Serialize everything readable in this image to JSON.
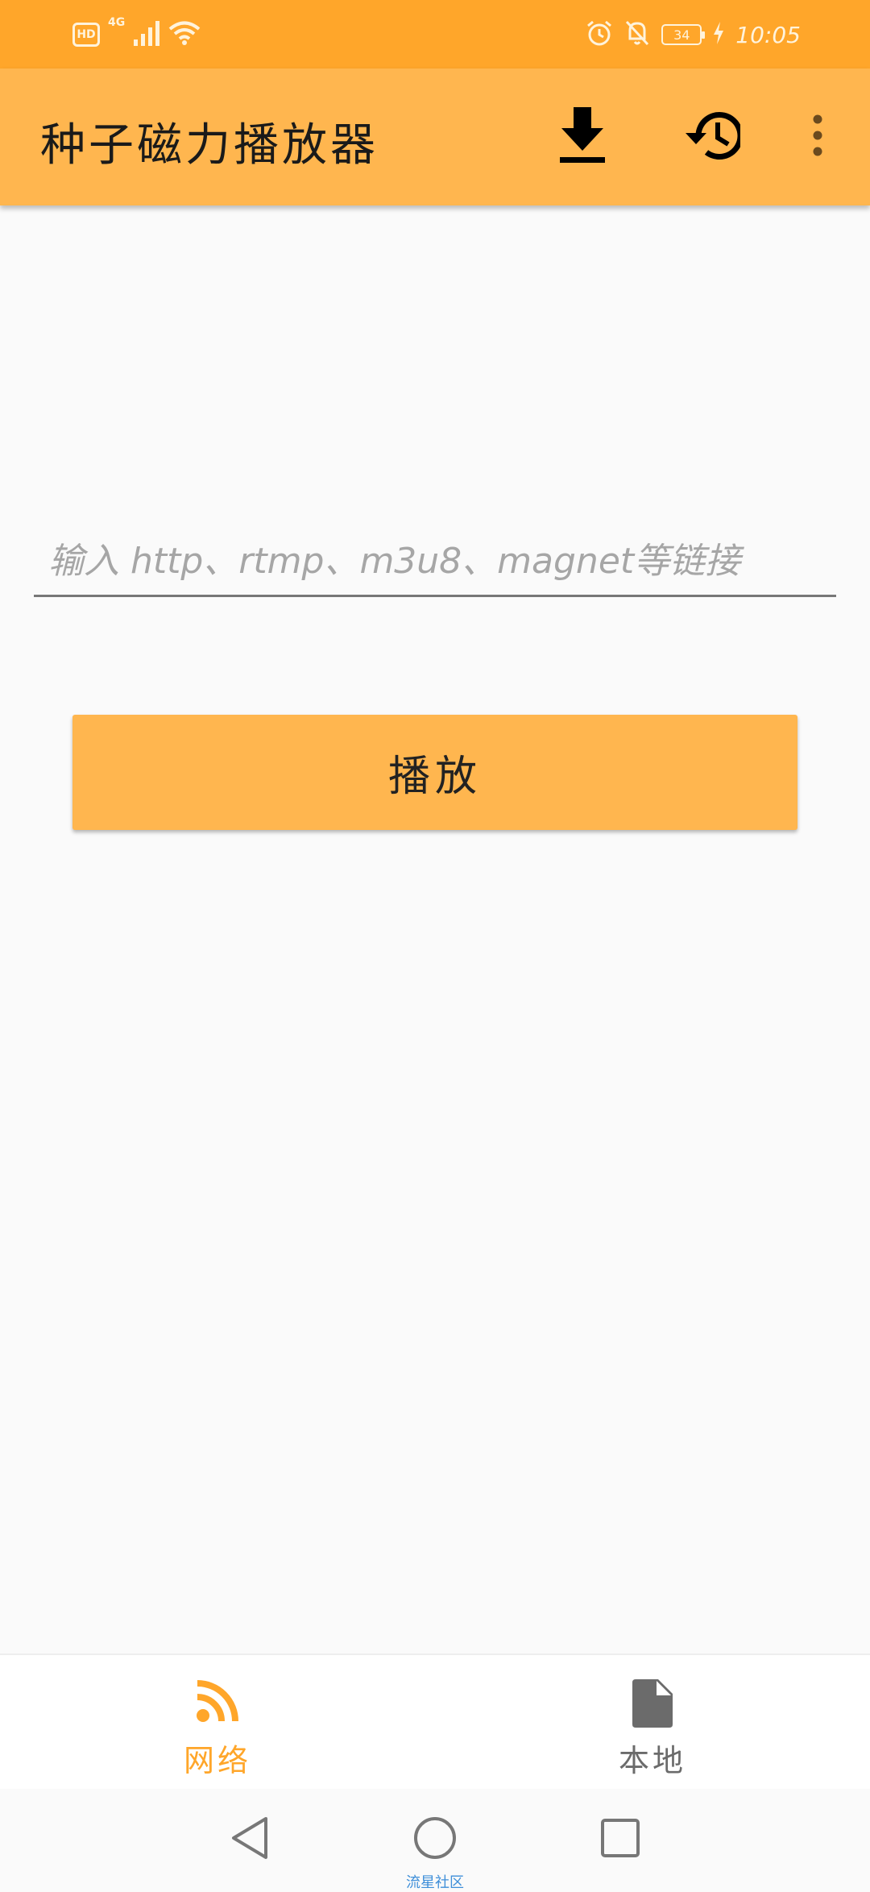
{
  "status_bar": {
    "hd_badge": "HD",
    "network_type": "4G",
    "battery_level": "34",
    "time": "10:05",
    "icons": [
      "signal-icon",
      "wifi-icon",
      "alarm-icon",
      "bell-off-icon",
      "battery-icon",
      "charging-icon"
    ]
  },
  "app_bar": {
    "title": "种子磁力播放器",
    "actions": [
      "download-icon",
      "history-icon",
      "more-vert-icon"
    ],
    "color": "#ffb64f"
  },
  "main": {
    "url_input": {
      "value": "",
      "placeholder": "输入 http、rtmp、m3u8、magnet等链接"
    },
    "play_button_label": "播放"
  },
  "bottom_nav": {
    "items": [
      {
        "label": "网络",
        "icon": "rss-feed-icon",
        "selected": true
      },
      {
        "label": "本地",
        "icon": "file-icon",
        "selected": false
      }
    ],
    "active_color": "#ffa62a"
  },
  "system_nav": {
    "watermark": "流星社区"
  }
}
